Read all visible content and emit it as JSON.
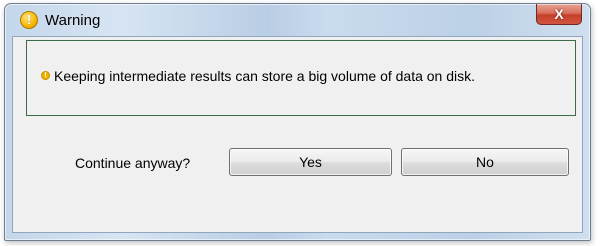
{
  "window": {
    "title": "Warning",
    "title_icon": "warning-icon",
    "close_glyph": "X"
  },
  "message": {
    "icon": "warning-icon",
    "text": "Keeping intermediate results can store a big volume of data on disk."
  },
  "prompt": {
    "label": "Continue anyway?",
    "yes_label": "Yes",
    "no_label": "No"
  },
  "colors": {
    "group_border": "#3d6b45",
    "warning_accent": "#f3b400",
    "close_button": "#c7402a"
  }
}
